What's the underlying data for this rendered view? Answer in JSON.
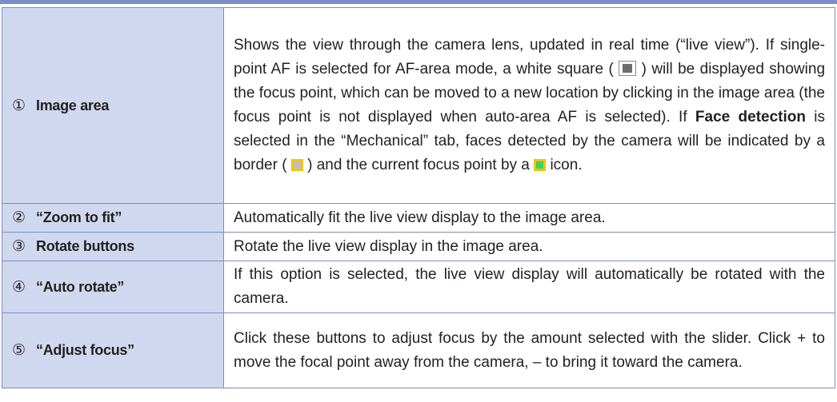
{
  "rows": [
    {
      "num": "①",
      "label": "Image area",
      "desc_part1": "Shows the view through the camera lens, updated in real time (“live view”). If single-point AF is selected for AF-area mode, a white square (",
      "desc_part2": ") will be displayed showing the focus point, which can be moved to a new location by clicking in the image area (the focus point is not displayed when auto-area AF is selected). If ",
      "desc_bold": "Face detection",
      "desc_part3": " is selected in the “Mechanical” tab, faces detected by the camera will be indicated by a border (",
      "desc_part4": ") and the current focus point by a",
      "desc_part5": "icon."
    },
    {
      "num": "②",
      "label": "“Zoom to fit”",
      "desc": "Automatically fit the live view display to the image area."
    },
    {
      "num": "③",
      "label": "Rotate buttons",
      "desc": "Rotate the live view display in the image area."
    },
    {
      "num": "④",
      "label": "“Auto rotate”",
      "desc": "If this option is selected, the live view display will automatically be rotated with the camera."
    },
    {
      "num": "⑤",
      "label": "“Adjust focus”",
      "desc": "Click these buttons to adjust focus by the amount selected with the slider. Click + to move the focal point away from the camera, – to bring it toward the camera."
    }
  ],
  "colors": {
    "label_bg": "#cfd8ee",
    "border": "#7b8dc8",
    "marker_yellow": "#f4c400",
    "marker_green": "#3bd35a"
  },
  "icons": [
    "white-square-icon",
    "face-border-icon",
    "focus-point-icon"
  ]
}
